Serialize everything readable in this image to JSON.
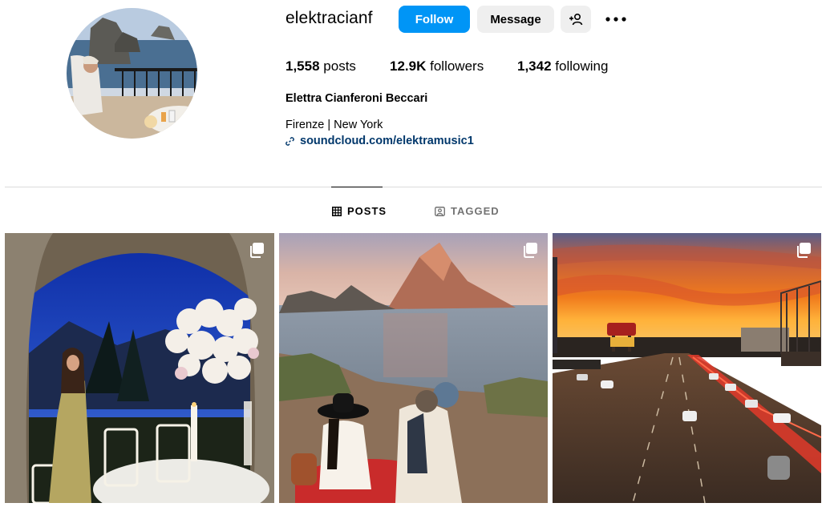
{
  "profile": {
    "username": "elektracianf",
    "full_name": "Elettra Cianferoni Beccari",
    "bio_line": "Firenze | New York",
    "link": "soundcloud.com/elektramusic1"
  },
  "actions": {
    "follow_label": "Follow",
    "message_label": "Message",
    "add_user_icon": "person-add-icon",
    "more_icon": "more-options-icon"
  },
  "stats": {
    "posts_count": "1,558",
    "posts_label": "posts",
    "followers_count": "12.9K",
    "followers_label": "followers",
    "following_count": "1,342",
    "following_label": "following"
  },
  "tabs": [
    {
      "label": "POSTS",
      "icon": "grid-icon",
      "active": true
    },
    {
      "label": "TAGGED",
      "icon": "tagged-icon",
      "active": false
    }
  ],
  "posts": [
    {
      "type": "carousel",
      "icon": "multiple-images-icon"
    },
    {
      "type": "carousel",
      "icon": "multiple-images-icon"
    },
    {
      "type": "carousel",
      "icon": "multiple-images-icon"
    }
  ],
  "colors": {
    "accent": "#0095f6",
    "secondary_button": "#efefef",
    "link": "#00376b",
    "muted": "#737373",
    "divider": "#dbdbdb"
  }
}
